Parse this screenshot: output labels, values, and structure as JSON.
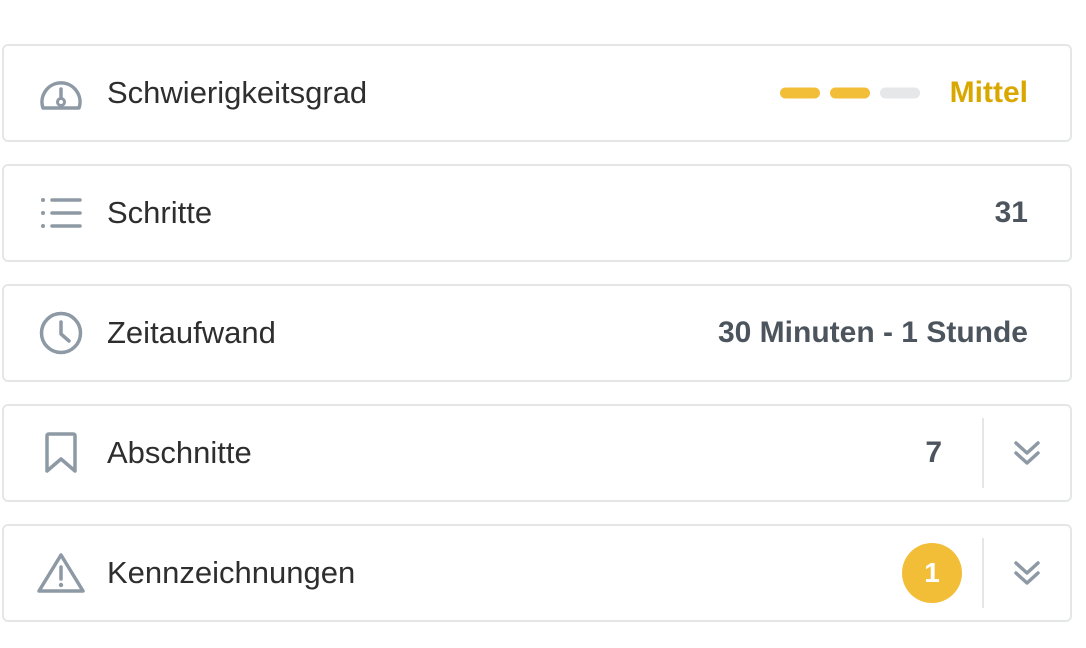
{
  "rows": [
    {
      "label": "Schwierigkeitsgrad",
      "icon": "gauge-icon",
      "value": "Mittel",
      "difficulty_level": 2,
      "difficulty_max": 3
    },
    {
      "label": "Schritte",
      "icon": "list-icon",
      "value": "31"
    },
    {
      "label": "Zeitaufwand",
      "icon": "clock-icon",
      "value": "30 Minuten - 1 Stunde"
    },
    {
      "label": "Abschnitte",
      "icon": "bookmark-icon",
      "value": "7",
      "toggle_icon": "chevron-double-down-icon"
    },
    {
      "label": "Kennzeichnungen",
      "icon": "warning-icon",
      "badge": "1",
      "toggle_icon": "chevron-double-down-icon"
    }
  ],
  "colors": {
    "accent": "#f3be37",
    "accent_text": "#d9a800",
    "icon": "#8d99a4",
    "value_text": "#4c555d",
    "border": "#e4e6e8",
    "inactive_bar": "#e6e7e8"
  }
}
